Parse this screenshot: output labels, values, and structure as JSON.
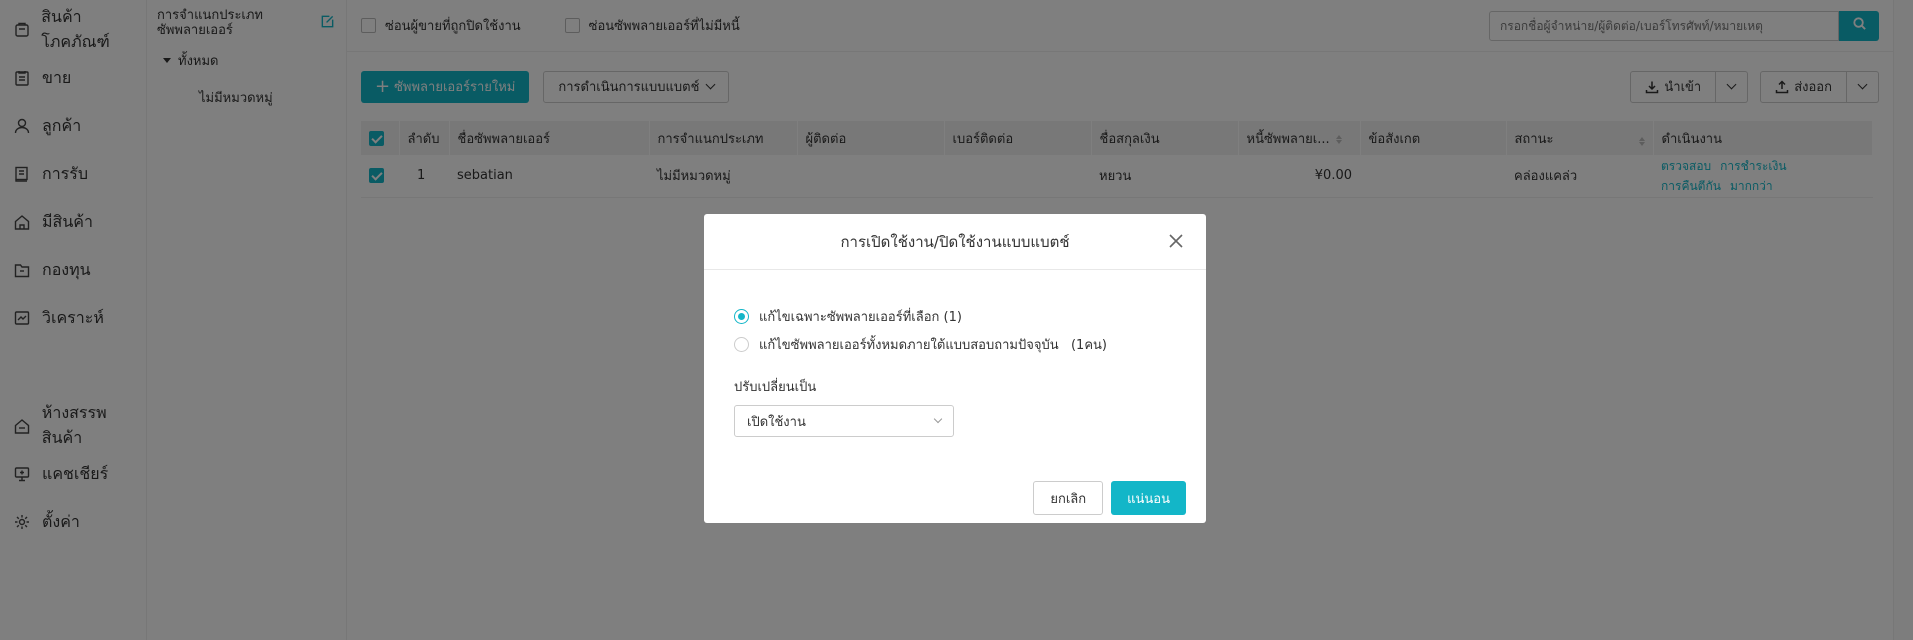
{
  "nav": {
    "items": [
      {
        "label": "สินค้าโภคภัณฑ์",
        "icon": "box-icon"
      },
      {
        "label": "ขาย",
        "icon": "clipboard-icon"
      },
      {
        "label": "ลูกค้า",
        "icon": "user-icon"
      },
      {
        "label": "การรับ",
        "icon": "book-icon"
      },
      {
        "label": "มีสินค้า",
        "icon": "home-icon"
      },
      {
        "label": "กองทุน",
        "icon": "folder-icon"
      },
      {
        "label": "วิเคราะห์",
        "icon": "chart-icon"
      }
    ],
    "bottom_items": [
      {
        "label": "ห้างสรรพสินค้า",
        "icon": "store-icon"
      },
      {
        "label": "แคชเชียร์",
        "icon": "monitor-icon"
      },
      {
        "label": "ตั้งค่า",
        "icon": "gear-icon"
      }
    ]
  },
  "category": {
    "title": "การจำแนกประเภท ซัพพลายเออร์",
    "root": "ทั้งหมด",
    "child": "ไม่มีหมวดหมู่"
  },
  "filters": {
    "hide_disabled": "ซ่อนผู้ขายที่ถูกปิดใช้งาน",
    "hide_no_debt": "ซ่อนซัพพลายเออร์ที่ไม่มีหนี้"
  },
  "search": {
    "placeholder": "กรอกชื่อผู้จำหน่าย/ผู้ติดต่อ/เบอร์โทรศัพท์/หมายเหตุ"
  },
  "toolbar": {
    "new_supplier": "ซัพพลายเออร์รายใหม่",
    "batch_ops": "การดำเนินการแบบแบตช์",
    "import": "นำเข้า",
    "export": "ส่งออก"
  },
  "table": {
    "headers": {
      "index": "ลำดับ",
      "name": "ชื่อซัพพลายเออร์",
      "category": "การจำแนกประเภท",
      "contact": "ผู้ติดต่อ",
      "phone": "เบอร์ติดต่อ",
      "currency": "ชื่อสกุลเงิน",
      "debt": "หนี้ซัพพลายเ...",
      "remark": "ข้อสังเกต",
      "status": "สถานะ",
      "ops": "ดำเนินงาน"
    },
    "rows": [
      {
        "index": "1",
        "name": "sebatian",
        "category": "ไม่มีหมวดหมู่",
        "contact": "",
        "phone": "",
        "currency": "หยวน",
        "debt": "¥0.00",
        "remark": "",
        "status": "คล่องแคล่ว",
        "ops": [
          "ตรวจสอบ",
          "การชำระเงิน",
          "การคืนตีกัน",
          "มากกว่า"
        ]
      }
    ]
  },
  "dialog": {
    "title": "การเปิดใช้งาน/ปิดใช้งานแบบแบตช์",
    "option_selected": "แก้ไขเฉพาะซัพพลายเออร์ที่เลือก (1)",
    "option_all": "แก้ไขซัพพลายเออร์ทั้งหมดภายใต้แบบสอบถามปัจจุบัน   (1คน)",
    "change_to_label": "ปรับเปลี่ยนเป็น",
    "change_to_value": "เปิดใช้งาน",
    "cancel": "ยกเลิก",
    "ok": "แน่นอน"
  },
  "colors": {
    "accent": "#13b6c8"
  }
}
